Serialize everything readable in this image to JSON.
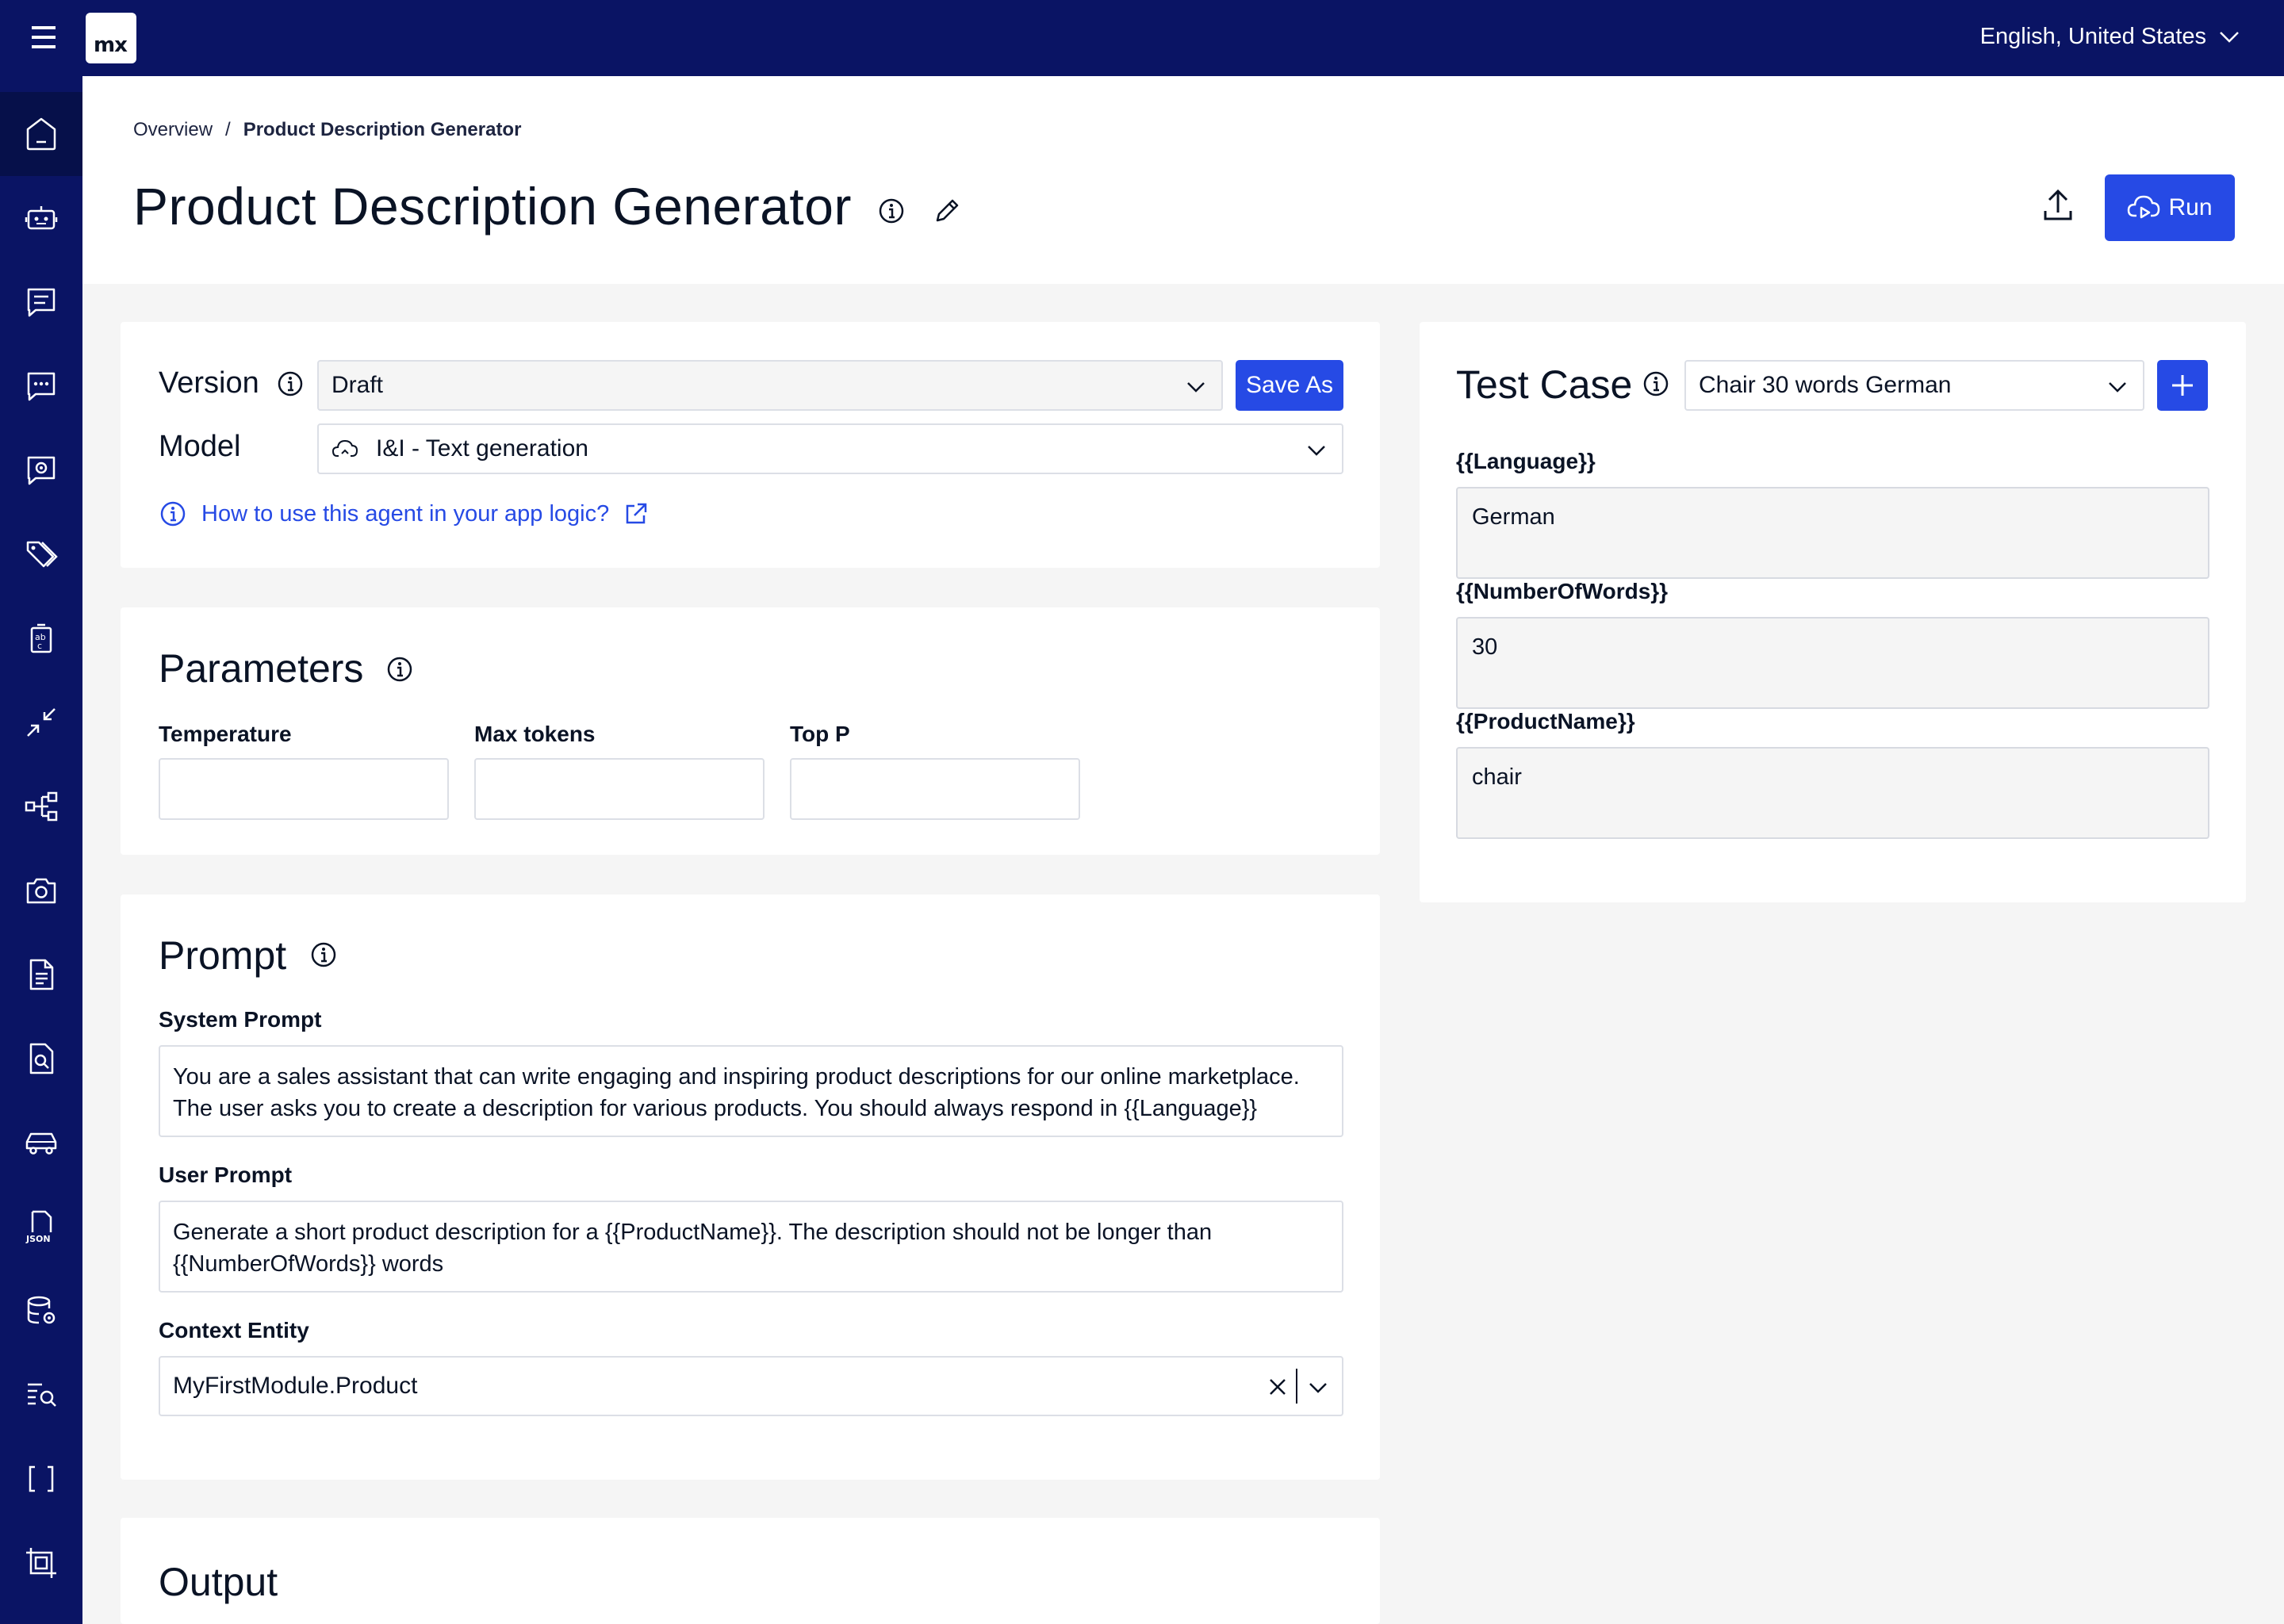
{
  "topbar": {
    "logo_text": "mx",
    "language": "English, United States"
  },
  "sidebar": {
    "items": [
      {
        "icon": "home-icon"
      },
      {
        "icon": "robot-icon"
      },
      {
        "icon": "chat-lines-icon"
      },
      {
        "icon": "chat-dots-icon"
      },
      {
        "icon": "chat-gear-icon"
      },
      {
        "icon": "tags-icon"
      },
      {
        "icon": "abc-clipboard-icon"
      },
      {
        "icon": "collapse-arrows-icon"
      },
      {
        "icon": "hierarchy-icon"
      },
      {
        "icon": "camera-icon"
      },
      {
        "icon": "document-icon"
      },
      {
        "icon": "document-search-icon"
      },
      {
        "icon": "car-icon"
      },
      {
        "icon": "json-file-icon"
      },
      {
        "icon": "database-gear-icon"
      },
      {
        "icon": "list-search-icon"
      },
      {
        "icon": "brackets-icon"
      },
      {
        "icon": "select-area-icon"
      }
    ]
  },
  "breadcrumb": {
    "parent": "Overview",
    "separator": "/",
    "current": "Product Description Generator"
  },
  "page": {
    "title": "Product Description Generator",
    "run_label": "Run"
  },
  "config": {
    "version_label": "Version",
    "version_value": "Draft",
    "save_as_label": "Save As",
    "model_label": "Model",
    "model_value": "I&I - Text generation",
    "help_link": "How to use this agent in your app logic?"
  },
  "parameters": {
    "heading": "Parameters",
    "fields": [
      {
        "label": "Temperature",
        "value": ""
      },
      {
        "label": "Max tokens",
        "value": ""
      },
      {
        "label": "Top P",
        "value": ""
      }
    ]
  },
  "prompt": {
    "heading": "Prompt",
    "system_label": "System Prompt",
    "system_value": "You are a sales assistant that can write engaging and inspiring product descriptions for our online marketplace. The user asks you to create a description for various products. You should always respond in {{Language}}",
    "user_label": "User Prompt",
    "user_value": "Generate a short product description for a {{ProductName}}. The description should not be longer than {{NumberOfWords}} words",
    "context_label": "Context Entity",
    "context_value": "MyFirstModule.Product"
  },
  "output": {
    "heading": "Output"
  },
  "test_case": {
    "heading": "Test Case",
    "selected": "Chair 30 words German",
    "variables": [
      {
        "name": "{{Language}}",
        "value": "German"
      },
      {
        "name": "{{NumberOfWords}}",
        "value": "30"
      },
      {
        "name": "{{ProductName}}",
        "value": "chair"
      }
    ]
  },
  "colors": {
    "navy": "#0a1464",
    "primary": "#264ae5",
    "background": "#f5f5f5"
  }
}
